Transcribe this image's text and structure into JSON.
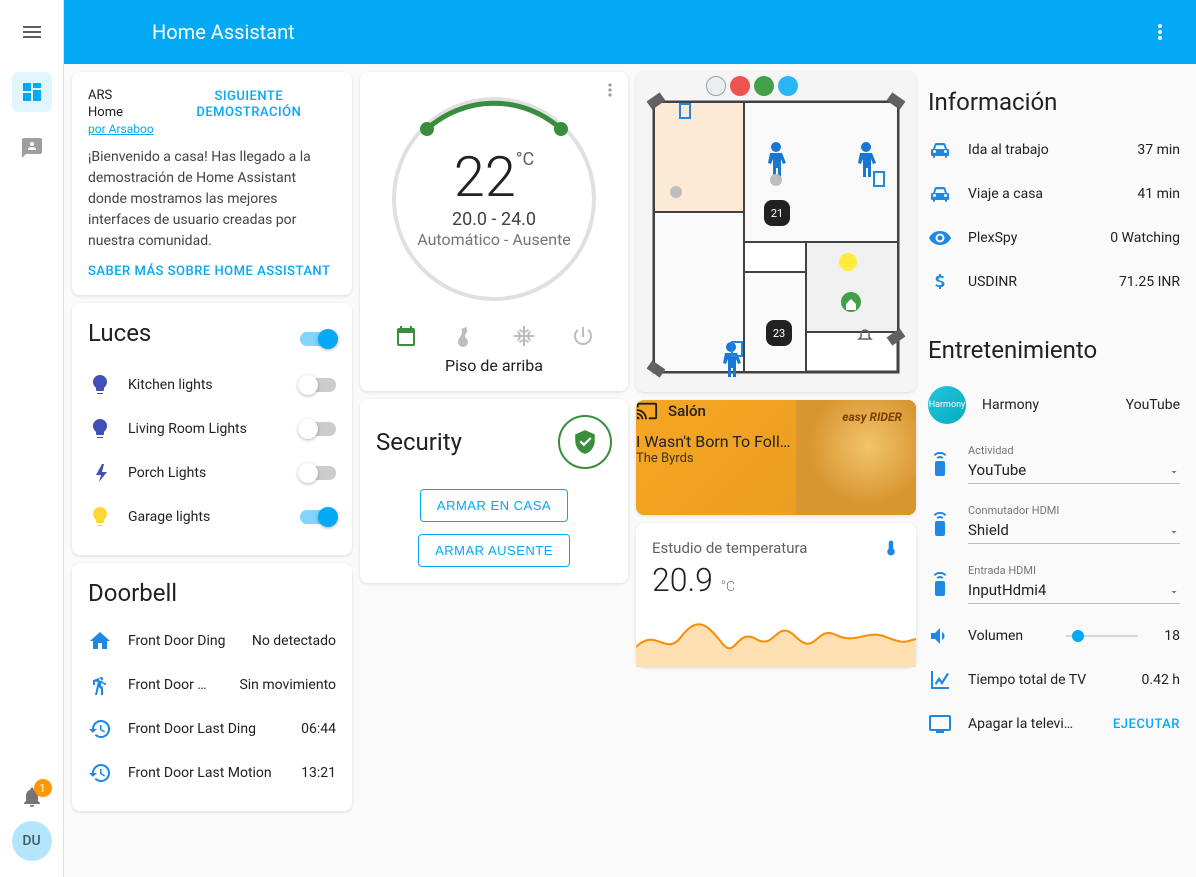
{
  "app_title": "Home Assistant",
  "notifications_count": "1",
  "user_initials": "DU",
  "welcome": {
    "line1": "ARS",
    "line2": "Home",
    "by_label": "por Arsaboo",
    "next_demo": "SIGUIENTE DEMOSTRACIÓN",
    "body": "¡Bienvenido a casa! Has llegado a la demostración de Home Assistant donde mostramos las mejores interfaces de usuario creadas por nuestra comunidad.",
    "learn_more": "SABER MÁS SOBRE HOME ASSISTANT"
  },
  "lights": {
    "title": "Luces",
    "master_on": true,
    "items": [
      {
        "label": "Kitchen lights",
        "on": false,
        "color": "#3f51b5"
      },
      {
        "label": "Living Room Lights",
        "on": false,
        "color": "#3f51b5"
      },
      {
        "label": "Porch Lights",
        "on": false,
        "color": "#3f51b5",
        "bolt": true
      },
      {
        "label": "Garage lights",
        "on": true,
        "color": "#fdd835"
      }
    ]
  },
  "doorbell": {
    "title": "Doorbell",
    "items": [
      {
        "icon": "home",
        "label": "Front Door Ding",
        "value": "No detectado"
      },
      {
        "icon": "walk",
        "label": "Front Door …",
        "value": "Sin movimiento"
      },
      {
        "icon": "history",
        "label": "Front Door Last Ding",
        "value": "06:44"
      },
      {
        "icon": "history",
        "label": "Front Door Last Motion",
        "value": "13:21"
      }
    ]
  },
  "thermostat": {
    "temp": "22",
    "unit": "°C",
    "range": "20.0 - 24.0",
    "mode": "Automático - Ausente",
    "floor": "Piso de arriba"
  },
  "security": {
    "title": "Security",
    "arm_home": "ARMAR EN CASA",
    "arm_away": "ARMAR AUSENTE"
  },
  "floor_temps": {
    "main": "21",
    "den": "23"
  },
  "media": {
    "room": "Salón",
    "track": "I Wasn't Born To Foll…",
    "artist": "The Byrds",
    "album_brand": "easy RIDER"
  },
  "temp_sensor": {
    "title": "Estudio de temperatura",
    "value": "20.9",
    "unit": "°C"
  },
  "info": {
    "title": "Información",
    "items": [
      {
        "icon": "car",
        "label": "Ida al trabajo",
        "value": "37 min"
      },
      {
        "icon": "car",
        "label": "Viaje a casa",
        "value": "41 min"
      },
      {
        "icon": "eye",
        "label": "PlexSpy",
        "value": "0 Watching"
      },
      {
        "icon": "dollar",
        "label": "USDINR",
        "value": "71.25 INR"
      }
    ]
  },
  "ent": {
    "title": "Entretenimiento",
    "harmony_label": "Harmony",
    "harmony_value": "YouTube",
    "selects": [
      {
        "label": "Actividad",
        "value": "YouTube"
      },
      {
        "label": "Conmutador HDMI",
        "value": "Shield"
      },
      {
        "label": "Entrada HDMI",
        "value": "InputHdmi4"
      }
    ],
    "volume_label": "Volumen",
    "volume_value": "18",
    "tv_time_label": "Tiempo total de TV",
    "tv_time_value": "0.42 h",
    "tv_off_label": "Apagar la televi…",
    "tv_off_action": "EJECUTAR"
  }
}
